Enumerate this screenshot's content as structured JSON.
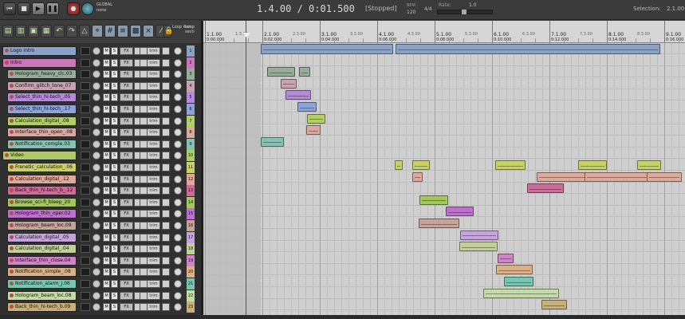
{
  "transport": {
    "buttons": [
      "⏮",
      "■",
      "▶",
      "❚❚",
      "●"
    ],
    "global_auto": "GLOBAL",
    "global_auto_mode": "none",
    "timecode": "1.4.00 / 0:01.500",
    "state": "[Stopped]",
    "bpm_label": "BPM",
    "bpm": "120",
    "timesig": "4/4",
    "rate_label": "Rate:",
    "rate": "1.0",
    "selection_label": "Selection:",
    "selection": "2.1.00"
  },
  "toolbar": {
    "loop_item_label": "Loop item",
    "loop_section_label": "Loop secti"
  },
  "ruler": [
    {
      "bar": "1.1.00",
      "time": "0:00.000"
    },
    {
      "bar": "2.1.00",
      "time": "0:02.000"
    },
    {
      "bar": "3.1.00",
      "time": "0:04.000"
    },
    {
      "bar": "4.1.00",
      "time": "0:06.000"
    },
    {
      "bar": "5.1.00",
      "time": "0:08.000"
    },
    {
      "bar": "6.1.00",
      "time": "0:10.000"
    },
    {
      "bar": "7.1.00",
      "time": "0:12.000"
    },
    {
      "bar": "8.1.00",
      "time": "0:14.000"
    },
    {
      "bar": "9.1.00",
      "time": "0:16.000"
    }
  ],
  "ruler_sub": [
    "1.3.00",
    "2.3.00",
    "3.3.00",
    "4.3.00",
    "5.3.00",
    "6.3.00",
    "7.3.00",
    "8.3.00"
  ],
  "track_controls": {
    "mute": "M",
    "solo": "S",
    "fx": "FX",
    "trim": "trim"
  },
  "tracks": [
    {
      "num": "1",
      "name": "Logo Intro",
      "color": "#8aa2c8",
      "folder": true,
      "indent": 0
    },
    {
      "num": "2",
      "name": "Intro",
      "color": "#c777ba",
      "folder": true,
      "indent": 0
    },
    {
      "num": "3",
      "name": "Hologram_heavy_clc.03",
      "color": "#97ad99",
      "folder": false,
      "indent": 1
    },
    {
      "num": "4",
      "name": "Confirm_glitch_tone_07",
      "color": "#c7a3b2",
      "folder": false,
      "indent": 1
    },
    {
      "num": "5",
      "name": "Select_thin_hi-tech_.05",
      "color": "#b58bd9",
      "folder": false,
      "indent": 1
    },
    {
      "num": "6",
      "name": "Select_thin_hi-tech_.17",
      "color": "#8ea4d8",
      "folder": false,
      "indent": 1
    },
    {
      "num": "7",
      "name": "Calculation_digital_.08",
      "color": "#b2cf63",
      "folder": false,
      "indent": 1
    },
    {
      "num": "8",
      "name": "Interface_thin_open_.08",
      "color": "#d9a9a0",
      "folder": false,
      "indent": 1
    },
    {
      "num": "9",
      "name": "Notification_comple.03",
      "color": "#86c1b4",
      "folder": false,
      "indent": 1
    },
    {
      "num": "10",
      "name": "Video",
      "color": "#aec96e",
      "folder": true,
      "indent": 0
    },
    {
      "num": "11",
      "name": "Frenetic_calculation_.06",
      "color": "#c7d165",
      "folder": false,
      "indent": 1
    },
    {
      "num": "12",
      "name": "Calculation_digital_.12",
      "color": "#dea99b",
      "folder": false,
      "indent": 1
    },
    {
      "num": "13",
      "name": "Back_thin_hi-tech_b_.12",
      "color": "#cb6d96",
      "folder": false,
      "indent": 1
    },
    {
      "num": "14",
      "name": "Browse_sci-fi_bleep_20",
      "color": "#a4c65e",
      "folder": false,
      "indent": 1
    },
    {
      "num": "15",
      "name": "Hologram_thin_oper.02",
      "color": "#c06fcf",
      "folder": false,
      "indent": 1
    },
    {
      "num": "16",
      "name": "Hologram_beam_loc.09",
      "color": "#c4a39b",
      "folder": false,
      "indent": 1
    },
    {
      "num": "17",
      "name": "Calculation_digital_.05",
      "color": "#c5a3dc",
      "folder": false,
      "indent": 1
    },
    {
      "num": "18",
      "name": "Calculation_digital_.04",
      "color": "#c3cf9b",
      "folder": false,
      "indent": 1
    },
    {
      "num": "19",
      "name": "Interface_thin_close.04",
      "color": "#d083c6",
      "folder": false,
      "indent": 1
    },
    {
      "num": "20",
      "name": "Notification_simple_.08",
      "color": "#dab187",
      "folder": false,
      "indent": 1
    },
    {
      "num": "21",
      "name": "Notification_alarm_j.06",
      "color": "#73c9ad",
      "folder": false,
      "indent": 1
    },
    {
      "num": "22",
      "name": "Hologram_beam_loc.08",
      "color": "#c5dba6",
      "folder": false,
      "indent": 1
    },
    {
      "num": "23",
      "name": "Back_thin_hi-tech_b.09",
      "color": "#c7b07c",
      "folder": false,
      "indent": 1
    }
  ]
}
